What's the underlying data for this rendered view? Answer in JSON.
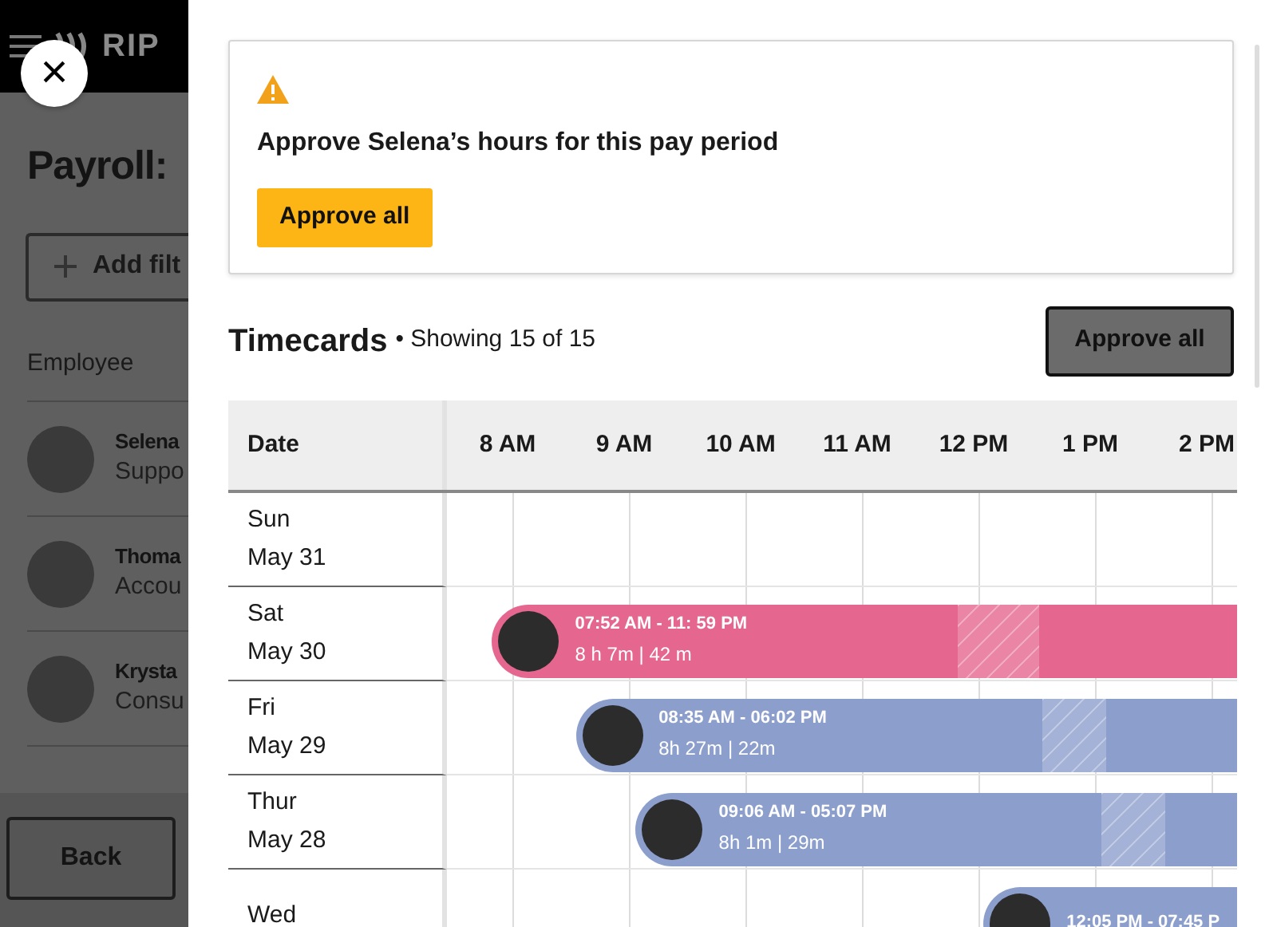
{
  "background_page": {
    "brand": "RIP",
    "title": "Payroll:",
    "filter_button": "Add filt",
    "column_header": "Employee",
    "employees": [
      {
        "name": "Selena",
        "role": "Suppo"
      },
      {
        "name": "Thoma",
        "role": "Accou"
      },
      {
        "name": "Krysta",
        "role": "Consu"
      }
    ],
    "back_button": "Back"
  },
  "close_button": "×",
  "alert": {
    "message": "Approve Selena’s hours for this pay period",
    "button": "Approve all"
  },
  "timecards": {
    "title": "Timecards",
    "summary": "• Showing 15 of 15",
    "button": "Approve all",
    "date_header": "Date",
    "hours": [
      "8 AM",
      "9 AM",
      "10 AM",
      "11 AM",
      "12 PM",
      "1 PM",
      "2 PM"
    ],
    "rows": [
      {
        "day": "Sun",
        "date": "May 31"
      },
      {
        "day": "Sat",
        "date": "May 30",
        "shift": {
          "times": "07:52 AM - 11: 59 PM",
          "duration": "8 h 7m | 42 m",
          "color": "#e5678f"
        }
      },
      {
        "day": "Fri",
        "date": "May 29",
        "shift": {
          "times": "08:35 AM - 06:02 PM",
          "duration": "8h 27m | 22m",
          "color": "#8c9fcc"
        }
      },
      {
        "day": "Thur",
        "date": "May 28",
        "shift": {
          "times": "09:06 AM - 05:07 PM",
          "duration": "8h 1m | 29m",
          "color": "#8c9fcc"
        }
      },
      {
        "day": "Wed",
        "shift": {
          "times": "12:05 PM - 07:45 P",
          "color": "#8c9fcc"
        }
      }
    ]
  }
}
